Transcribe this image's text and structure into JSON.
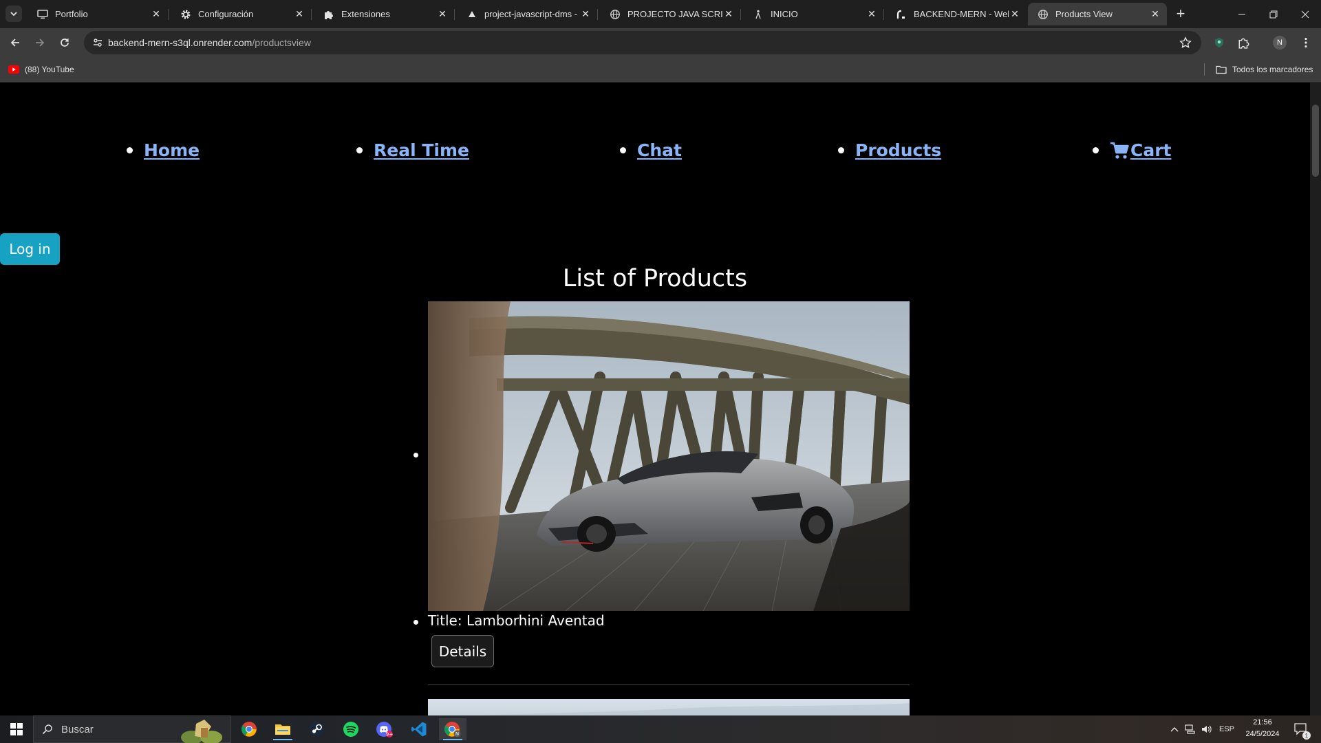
{
  "browser": {
    "tabs": [
      {
        "title": "Portfolio",
        "icon": "monitor-icon"
      },
      {
        "title": "Configuración",
        "icon": "gear-icon"
      },
      {
        "title": "Extensiones",
        "icon": "puzzle-icon"
      },
      {
        "title": "project-javascript-dms - C",
        "icon": "triangle-icon"
      },
      {
        "title": "PROJECTO JAVA SCRIPT",
        "icon": "globe-icon"
      },
      {
        "title": "INICIO",
        "icon": "figure-icon"
      },
      {
        "title": "BACKEND-MERN - Web S",
        "icon": "render-icon"
      },
      {
        "title": "Products View",
        "icon": "globe-icon",
        "active": true
      }
    ],
    "url_host": "backend-mern-s3ql.onrender.com",
    "url_path": "/productsview",
    "profile_initial": "N",
    "bookmarks": [
      {
        "label": "(88) YouTube",
        "icon": "youtube-icon"
      }
    ],
    "all_bookmarks_label": "Todos los marcadores"
  },
  "page": {
    "nav": [
      {
        "label": "Home"
      },
      {
        "label": "Real Time"
      },
      {
        "label": "Chat"
      },
      {
        "label": "Products"
      },
      {
        "label": "Cart",
        "icon": "cart-icon"
      }
    ],
    "login_label": "Log in",
    "list_title": "List of Products",
    "products": [
      {
        "title_prefix": "Title: ",
        "title": "Lamborhini Aventad",
        "details_label": "Details"
      }
    ]
  },
  "taskbar": {
    "search_placeholder": "Buscar",
    "language": "ESP",
    "time": "21:56",
    "date": "24/5/2024",
    "notification_count": "1",
    "colors": {
      "accent": "#76b9ed"
    }
  },
  "colors": {
    "link": "#8ab4f8",
    "login_button": "#17a2c4",
    "page_background": "#000000"
  }
}
